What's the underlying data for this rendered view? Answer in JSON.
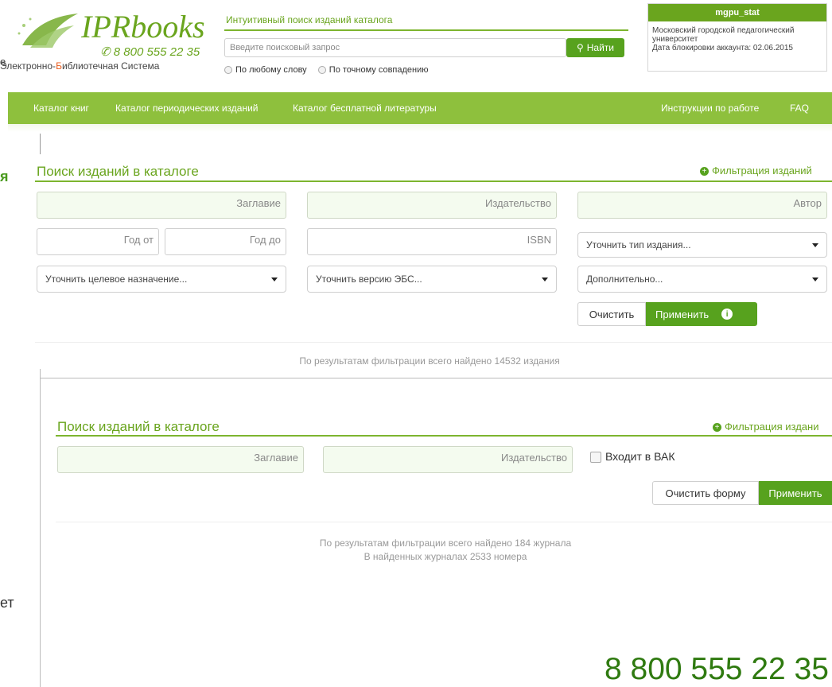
{
  "logo": {
    "brand": "IPRbooks",
    "phone": "8 800 555 22 35",
    "subtitle_pre": "Электронно-",
    "subtitle_b": "Б",
    "subtitle_post": "иблиотечная Система"
  },
  "search": {
    "title": "Интуитивный поиск изданий каталога",
    "placeholder": "Введите поисковый запрос",
    "button_label": "Найти",
    "option_any": "По любому слову",
    "option_exact": "По точному совпадению"
  },
  "user": {
    "name": "mgpu_stat",
    "org": "Московский городской педагогический университет",
    "block_date": "Дата блокировки аккаунта: 02.06.2015"
  },
  "nav": {
    "items": [
      "Каталог книг",
      "Каталог периодических изданий",
      "Каталог бесплатной литературы"
    ],
    "right": [
      "Инструкции по работе",
      "FAQ"
    ]
  },
  "books": {
    "title": "Поиск изданий в каталоге",
    "filter_link": "Фильтрация изданий",
    "fields": {
      "title": "Заглавие",
      "publisher": "Издательство",
      "author": "Автор",
      "year_from": "Год от",
      "year_to": "Год до",
      "isbn": "ISBN"
    },
    "selects": {
      "type": "Уточнить тип издания...",
      "purpose": "Уточнить целевое назначение...",
      "version": "Уточнить версию ЭБС...",
      "extra": "Дополнительно..."
    },
    "clear": "Очистить",
    "apply": "Применить",
    "result": "По результатам фильтрации всего найдено 14532 издания"
  },
  "journals": {
    "title": "Поиск изданий в каталоге",
    "filter_link": "Фильтрация издани",
    "fields": {
      "title": "Заглавие",
      "publisher": "Издательство"
    },
    "vak": "Входит в ВАК",
    "clear": "Очистить форму",
    "apply": "Применить",
    "result_line1": "По результатам фильтрации всего найдено 184 журнала",
    "result_line2": "В найденных журналах 2533 номера"
  },
  "footer_phone": "8 800 555 22 35",
  "left_fragments": {
    "top": "е",
    "mid": "я",
    "bottom": "ет"
  },
  "colors": {
    "accent": "#6aa51e",
    "nav": "#8ec03d",
    "button": "#57a21e"
  }
}
